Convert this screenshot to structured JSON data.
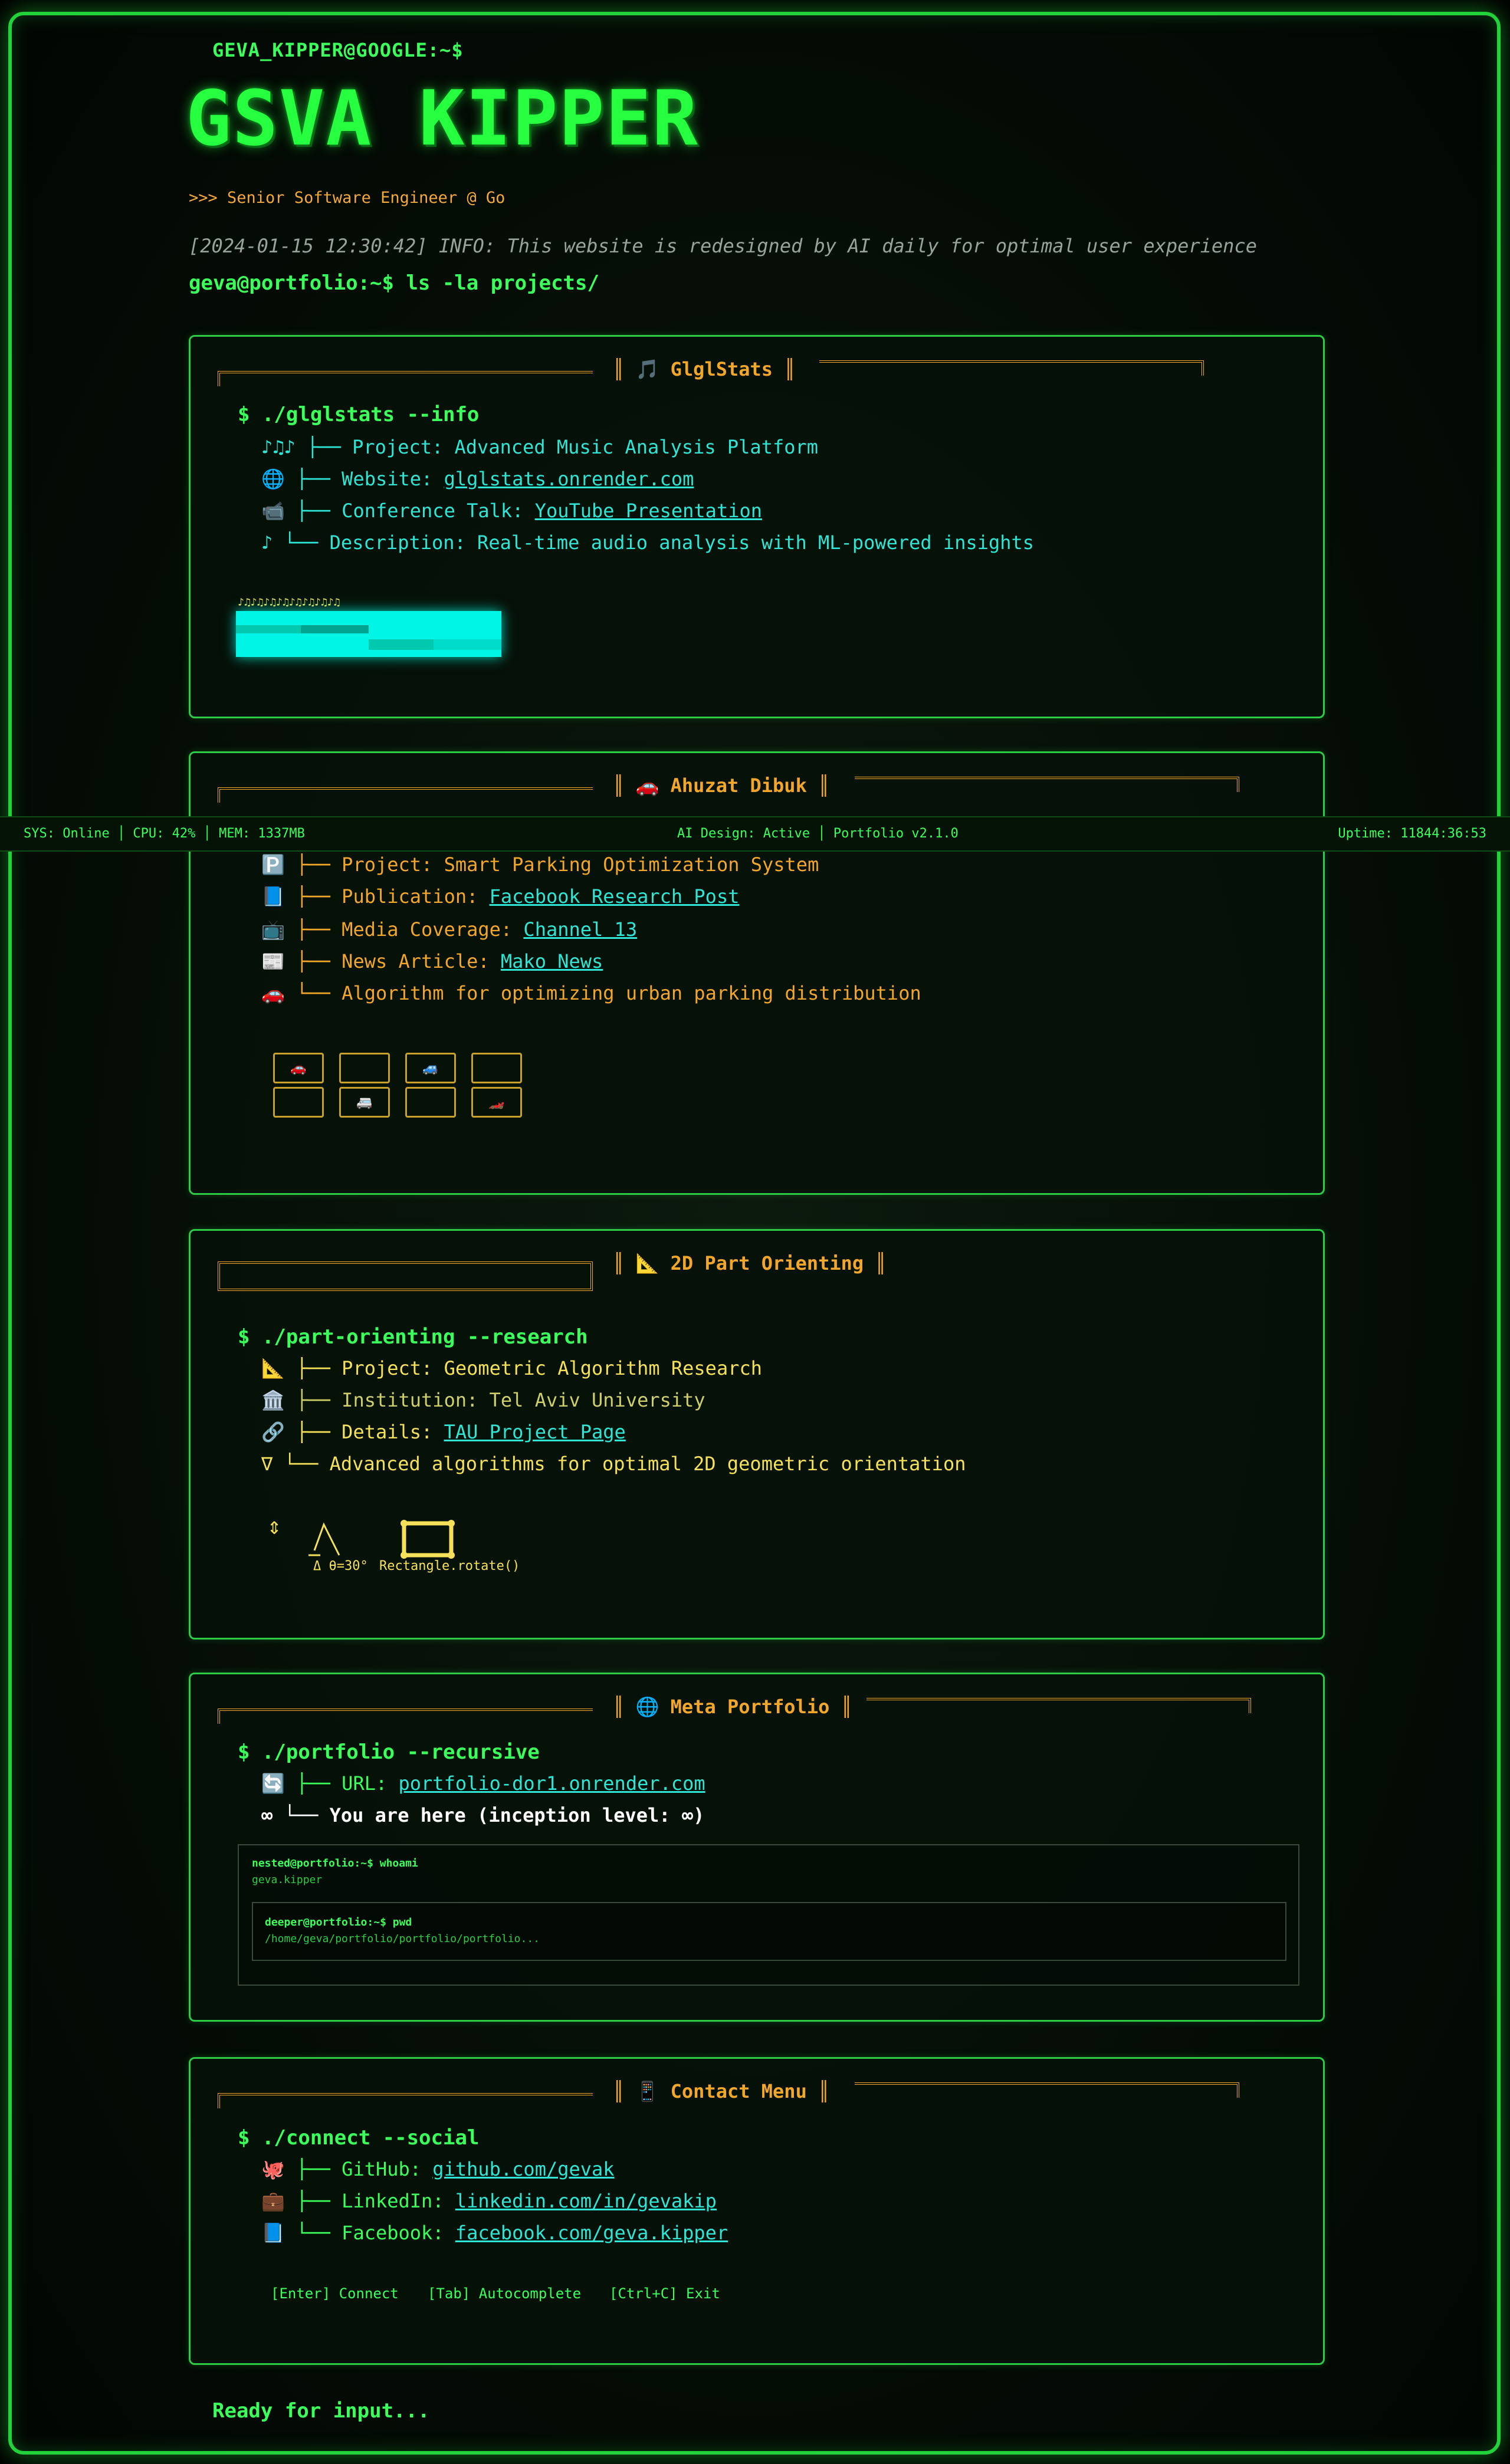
{
  "header": {
    "user_host": "GEVA_KIPPER@GOOGLE:~$",
    "name": "GSVA KIPPER",
    "subtitle": ">>> Senior Software Engineer @ Go",
    "log": "[2024-01-15 12:30:42] INFO: This website is redesigned by AI daily for optimal user experience",
    "command": "geva@portfolio:~$ ls -la projects/"
  },
  "status_bar": {
    "left": "SYS: Online │ CPU: 42% │ MEM: 1337MB",
    "center": "AI Design: Active │ Portfolio v2.1.0",
    "right": "Uptime: 11844:36:53"
  },
  "projects": {
    "glglstats": {
      "title": "🎵 GlglStats",
      "command": "$ ./glglstats --info",
      "project": "♪♫♪ ├── Project: Advanced Music Analysis Platform",
      "website_prefix": "🌐 ├── Website: ",
      "website_link": "glglstats.onrender.com",
      "talk_prefix": "📹 ├── Conference Talk: ",
      "talk_link": "YouTube Presentation",
      "description": "♪ └── Description: Real-time audio analysis with ML-powered insights",
      "notes": "♪♫♪♫♪♫♪♫♪♫♪♫♪♫♪♫"
    },
    "ahuzat": {
      "title": "🚗 Ahuzat Dibuk",
      "project": "🅿️ ├── Project: Smart Parking Optimization System",
      "publication_prefix": "📘 ├── Publication: ",
      "publication_link": "Facebook Research Post",
      "media_prefix": "📺 ├── Media Coverage: ",
      "media_link": "Channel 13",
      "news_prefix": "📰 ├── News Article: ",
      "news_link": "Mako News",
      "algorithm": "🚗 └── Algorithm for optimizing urban parking distribution",
      "cars": [
        "🚗",
        "",
        "🚙",
        "",
        "",
        "🚐",
        "",
        "🏎️"
      ]
    },
    "part_orienting": {
      "title": "📐 2D Part Orienting",
      "command": "$ ./part-orienting --research",
      "project": "📐 ├── Project: Geometric Algorithm Research",
      "institution": "🏛️ ├── Institution: Tel Aviv University",
      "details_prefix": "🔗 ├── Details: ",
      "details_link": "TAU Project Page",
      "advanced": "∇ └── Advanced algorithms for optimal 2D geometric orientation",
      "triangle_label": "Δ θ=30°",
      "rect_label": "Rectangle.rotate()",
      "arrows": "⇕"
    },
    "meta": {
      "title": "🌐 Meta Portfolio",
      "command": "$ ./portfolio --recursive",
      "url_prefix": "🔄 ├── URL: ",
      "url_link": "portfolio-dor1.onrender.com",
      "here": "∞ └── You are here (inception level: ∞)",
      "nested_cmd": "nested@portfolio:~$ whoami",
      "nested_out": "geva.kipper",
      "deeper_cmd": "deeper@portfolio:~$ pwd",
      "deeper_out": "/home/geva/portfolio/portfolio/portfolio..."
    },
    "contact": {
      "title": "📱 Contact Menu",
      "command": "$ ./connect --social",
      "github_prefix": "🐙 ├── GitHub: ",
      "github_link": "github.com/gevak",
      "linkedin_prefix": "💼 ├── LinkedIn: ",
      "linkedin_link": "linkedin.com/in/gevakip",
      "facebook_prefix": "📘 └── Facebook: ",
      "facebook_link": "facebook.com/geva.kipper",
      "key_enter": "[Enter] Connect",
      "key_tab": "[Tab] Autocomplete",
      "key_ctrlc": "[Ctrl+C] Exit"
    }
  },
  "footer": {
    "ready": "Ready for input..."
  },
  "colors": {
    "accent": "#3bff5a",
    "orange": "#f2a62a",
    "cyan": "#2fe6d6",
    "yellow": "#f5e05a"
  }
}
